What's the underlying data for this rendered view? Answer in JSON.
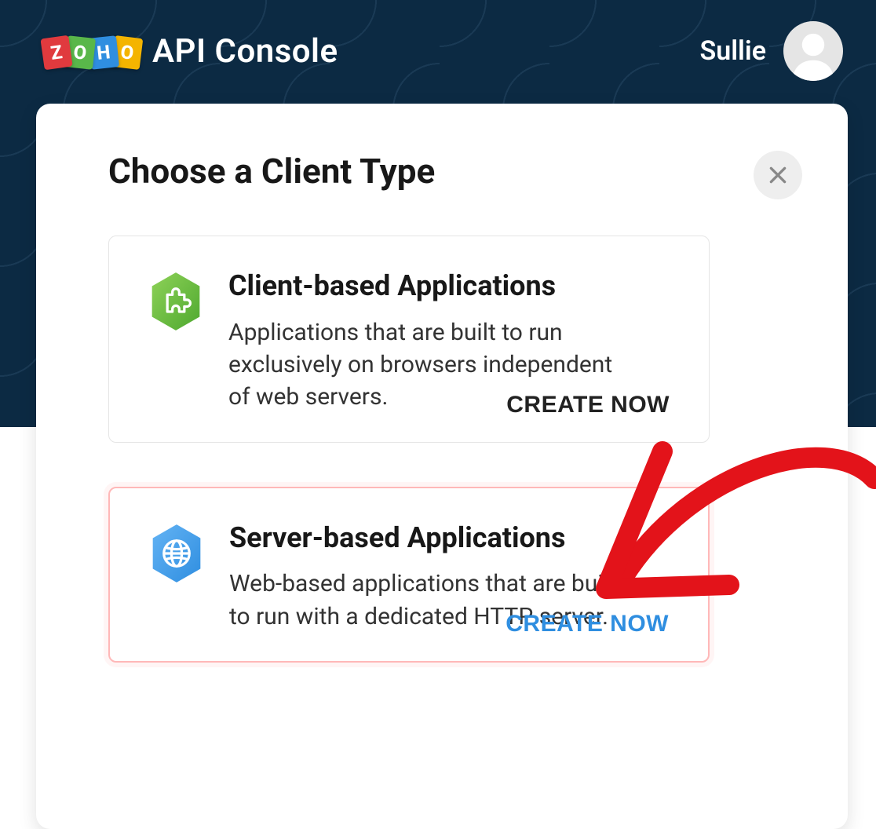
{
  "header": {
    "brand_word": "ZOHO",
    "brand_title": "API Console",
    "user_name": "Sullie"
  },
  "modal": {
    "title": "Choose a Client Type",
    "options": [
      {
        "icon": "puzzle-hex-icon",
        "title": "Client-based Applications",
        "description": "Applications that are built to run exclusively on browsers independent of web servers.",
        "action_label": "CREATE NOW",
        "highlighted": false
      },
      {
        "icon": "globe-hex-icon",
        "title": "Server-based Applications",
        "description": "Web-based applications that are built to run with a dedicated HTTP server.",
        "action_label": "CREATE NOW",
        "highlighted": true
      }
    ]
  },
  "colors": {
    "header_bg": "#0c2a43",
    "accent_blue": "#2f8ee0",
    "annotation_red": "#e3131a"
  }
}
